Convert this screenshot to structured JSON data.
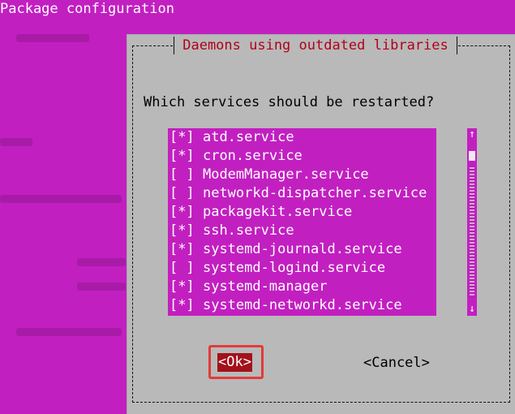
{
  "window": {
    "title": "Package configuration"
  },
  "dialog": {
    "title": "Daemons using outdated libraries",
    "question": "Which services should be restarted?",
    "services": [
      {
        "checkbox": "[*]",
        "name": "atd.service"
      },
      {
        "checkbox": "[*]",
        "name": "cron.service"
      },
      {
        "checkbox": "[ ]",
        "name": "ModemManager.service"
      },
      {
        "checkbox": "[ ]",
        "name": "networkd-dispatcher.service"
      },
      {
        "checkbox": "[*]",
        "name": "packagekit.service"
      },
      {
        "checkbox": "[*]",
        "name": "ssh.service"
      },
      {
        "checkbox": "[*]",
        "name": "systemd-journald.service"
      },
      {
        "checkbox": "[ ]",
        "name": "systemd-logind.service"
      },
      {
        "checkbox": "[*]",
        "name": "systemd-manager"
      },
      {
        "checkbox": "[*]",
        "name": "systemd-networkd.service"
      }
    ],
    "scroll": {
      "up_icon": "↑",
      "down_icon": "↓"
    },
    "buttons": {
      "ok": "<Ok>",
      "cancel": "<Cancel>"
    }
  },
  "colors": {
    "background": "#c21fc1",
    "dialog_bg": "#b9b9b9",
    "title_text": "#b3001b",
    "ok_selected_bg": "#a3121b",
    "highlight_border": "#e23b3b"
  }
}
